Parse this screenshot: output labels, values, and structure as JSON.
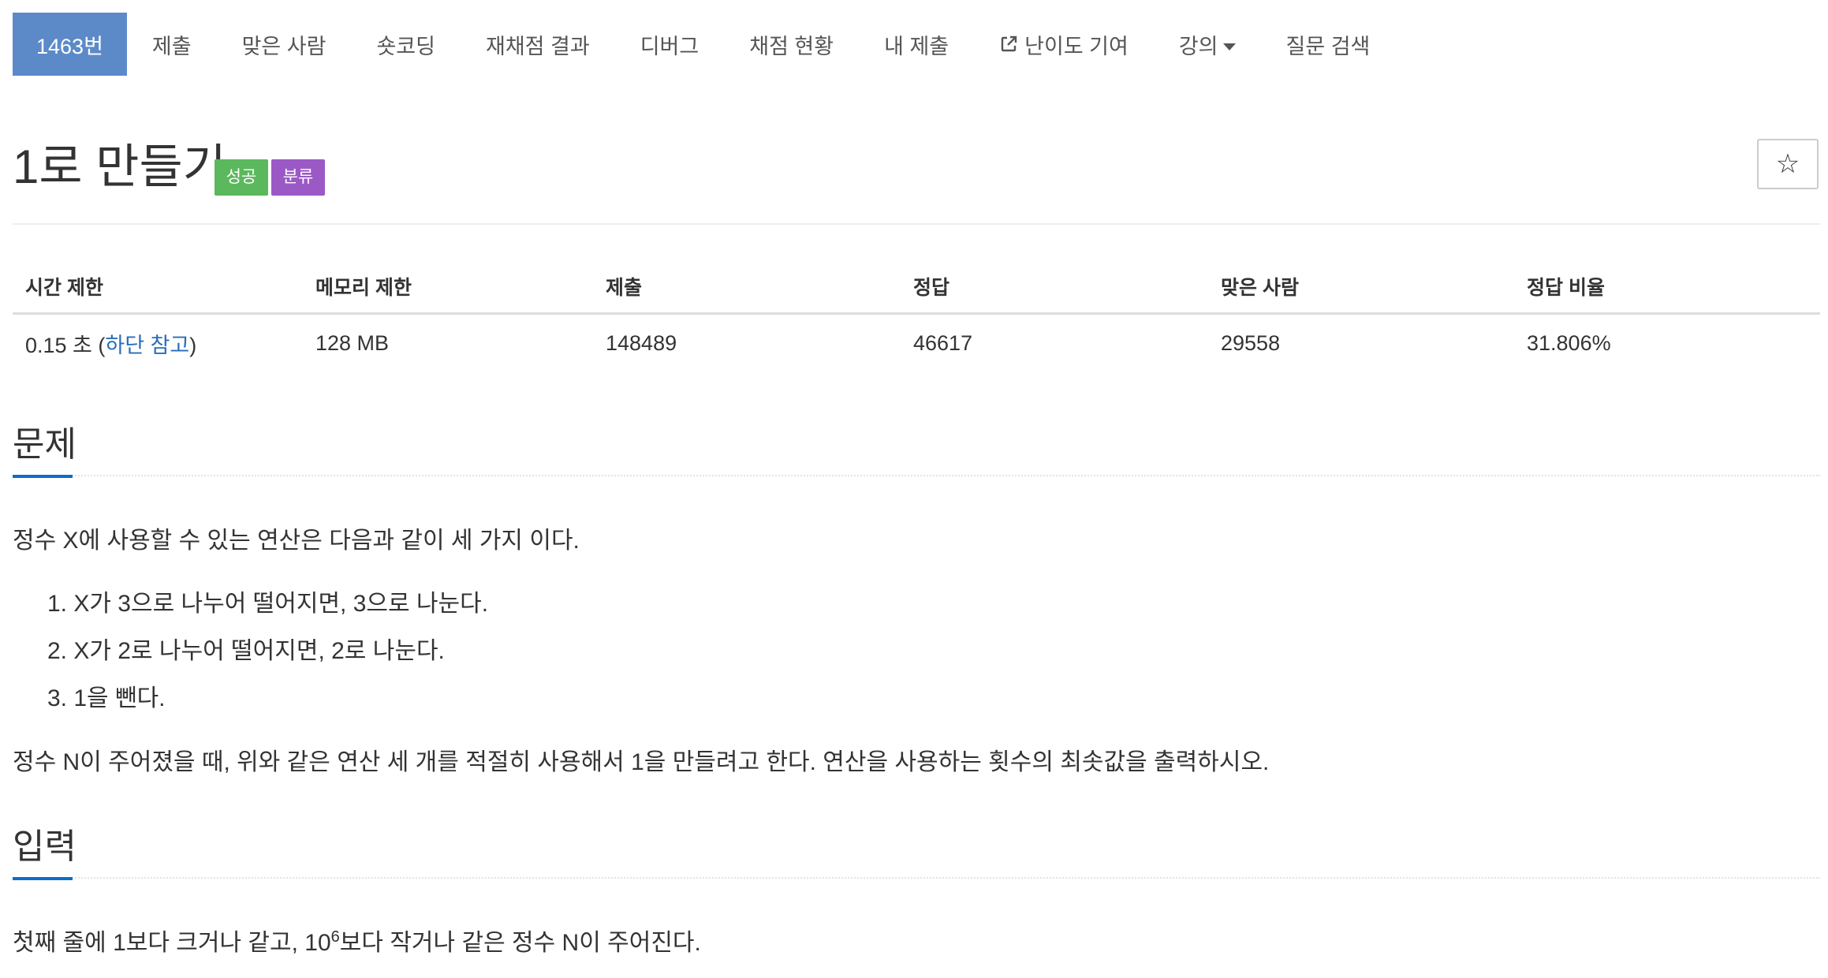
{
  "nav": {
    "tabs": [
      {
        "label": "1463번",
        "active": true
      },
      {
        "label": "제출"
      },
      {
        "label": "맞은 사람"
      },
      {
        "label": "숏코딩"
      },
      {
        "label": "재채점 결과"
      },
      {
        "label": "디버그"
      },
      {
        "label": "채점 현황"
      },
      {
        "label": "내 제출"
      },
      {
        "label": "난이도 기여",
        "icon": "external-link-icon"
      },
      {
        "label": "강의",
        "icon": "caret-down-icon"
      },
      {
        "label": "질문 검색"
      }
    ]
  },
  "problem": {
    "title": "1로 만들기",
    "badge_success": "성공",
    "badge_category": "분류",
    "star_icon": "☆"
  },
  "info_table": {
    "headers": [
      "시간 제한",
      "메모리 제한",
      "제출",
      "정답",
      "맞은 사람",
      "정답 비율"
    ],
    "time_value": "0.15 초 (",
    "time_link": "하단 참고",
    "time_suffix": ")",
    "memory": "128 MB",
    "submissions": "148489",
    "accepted": "46617",
    "solvers": "29558",
    "ratio": "31.806%"
  },
  "sections": {
    "problem_heading": "문제",
    "problem_intro": "정수 X에 사용할 수 있는 연산은 다음과 같이 세 가지 이다.",
    "ops": [
      "1. X가 3으로 나누어 떨어지면, 3으로 나눈다.",
      "2. X가 2로 나누어 떨어지면, 2로 나눈다.",
      "3. 1을 뺀다."
    ],
    "problem_goal": "정수 N이 주어졌을 때, 위와 같은 연산 세 개를 적절히 사용해서 1을 만들려고 한다. 연산을 사용하는 횟수의 최솟값을 출력하시오.",
    "input_heading": "입력",
    "input_prefix": "첫째 줄에 1보다 크거나 같고, 10",
    "input_sup": "6",
    "input_suffix": "보다 작거나 같은 정수 N이 주어진다."
  },
  "colors": {
    "active_tab": "#5c8ac9",
    "badge_success": "#5cb85c",
    "badge_category": "#9b59c6",
    "link": "#2a6eb8",
    "section_underline": "#0d6dc9"
  }
}
